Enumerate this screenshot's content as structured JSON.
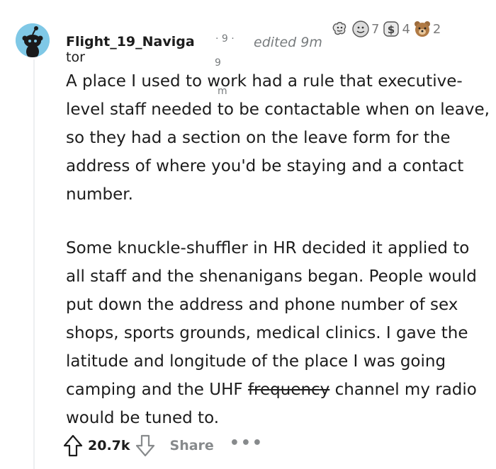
{
  "comment": {
    "username_line1": "Flight_19_Naviga",
    "username_line2": "tor",
    "edited_label": "edited 9m",
    "stray_glyphs": {
      "dot_nine_top": "· 9  ·",
      "nine_mid": "9",
      "m_under": "m"
    },
    "awards": [
      {
        "icon": "wholesome-seal-icon",
        "count": ""
      },
      {
        "icon": "silver-award-icon",
        "count": "7"
      },
      {
        "icon": "dollar-coin-award-icon",
        "count": "4"
      },
      {
        "icon": "bear-award-icon",
        "count": "2"
      }
    ],
    "paragraphs": [
      "A place I used to work had a rule that executive-level staff needed to be contactable when on leave, so they had a section on the leave form for the address of where you'd be staying and a contact number.",
      "Some knuckle-shuffler in HR decided it applied to all staff and the shenanigans began. People would put down the address and phone number of sex shops, sports grounds, medical clinics. I gave the latitude and longitude of the place I was going camping and the UHF"
    ],
    "strikethrough_word": "frequency",
    "paragraph2_end": " channel my radio would be tuned to."
  },
  "actions": {
    "vote_count": "20.7k",
    "share_label": "Share",
    "more_label": "•••"
  },
  "colors": {
    "avatar_bg": "#7fc8e6",
    "muted_text": "#787c7e",
    "action_gray": "#878a8c"
  }
}
